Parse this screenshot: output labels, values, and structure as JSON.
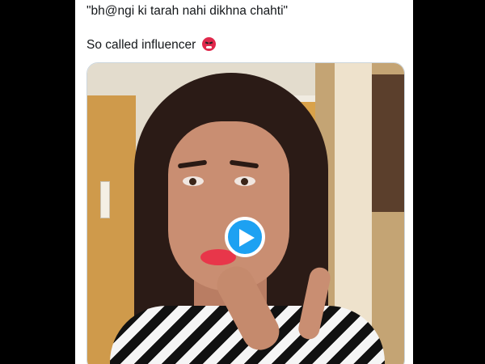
{
  "tweet": {
    "line1": "\"bh@ngi ki tarah nahi dikhna chahti\"",
    "line2": "So called influencer",
    "emoji": "face-with-symbols-on-mouth"
  },
  "media": {
    "type": "video",
    "play_icon": "play-icon"
  },
  "colors": {
    "play_button": "#1da1f2",
    "text": "#14171a",
    "card_background": "#ffffff"
  }
}
